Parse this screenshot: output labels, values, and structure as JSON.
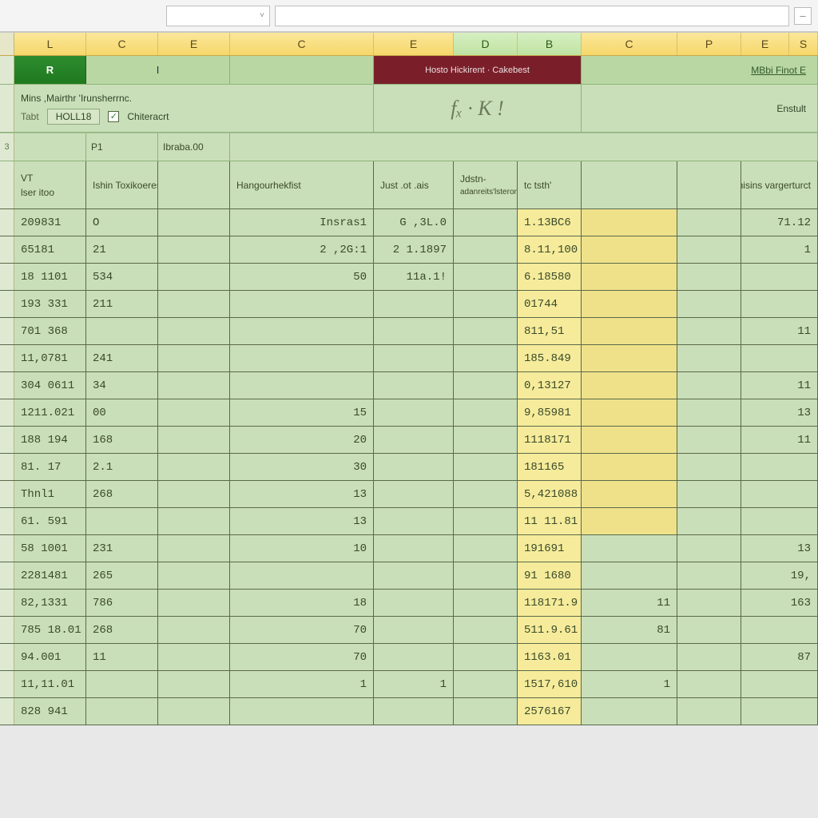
{
  "formula_bar": {
    "name_box": "",
    "dropdown_glyph": "˅"
  },
  "column_headers": [
    "L",
    "C",
    "E",
    "C",
    "E",
    "D",
    "B",
    "C",
    "P",
    "E",
    "S"
  ],
  "band": {
    "active_tab": "R",
    "tab2": "I",
    "maroon_label": "Hosto Hickirent · Cakebest",
    "right_link": "MBbi Finot E"
  },
  "toolrow": {
    "left_label": "Mins ,Mairthr 'Irunsherrnc.",
    "box_label": "HOLL18",
    "checkbox_label": "Chiteracrt",
    "checkbox_checked": true,
    "fx_label": "fₓ · K !",
    "right_link": "Enstult"
  },
  "labelrow": {
    "rowhead": "3",
    "left1": "P1",
    "left2": "Ibraba.00"
  },
  "header_row": {
    "a": "lser   itoo",
    "b": "VT",
    "d1": "Ishin Toxikoeres",
    "d2": "Hangourhekfist",
    "e": "Just .ot .ais",
    "f": "Jdstn-",
    "g": "adanreits'lsterorl",
    "h": "tc tsth'",
    "i": "",
    "j": "vhisins vargerturct"
  },
  "rows": [
    {
      "a": "209831",
      "b": "O",
      "c": "",
      "d": "Insras1",
      "e": "G ,3L.0",
      "f": "",
      "g": "1.13BC6",
      "h": "",
      "i": "",
      "j": "71.12"
    },
    {
      "a": "65181",
      "b": "21",
      "c": "",
      "d": "2  ,2G:1",
      "e": "2 1.1897",
      "f": "",
      "g": "8.11,100",
      "h": "",
      "i": "",
      "j": "1"
    },
    {
      "a": "18 1101",
      "b": "534",
      "c": "",
      "d": "50",
      "e": "11a.1!",
      "f": "",
      "g": "6.18580",
      "h": "",
      "i": "",
      "j": ""
    },
    {
      "a": "193 331",
      "b": "211",
      "c": "",
      "d": "",
      "e": "",
      "f": "",
      "g": "01744",
      "h": "",
      "i": "",
      "j": ""
    },
    {
      "a": "701 368",
      "b": "",
      "c": "",
      "d": "",
      "e": "",
      "f": "",
      "g": "811,51",
      "h": "",
      "i": "",
      "j": "11"
    },
    {
      "a": "11,0781",
      "b": "241",
      "c": "",
      "d": "",
      "e": "",
      "f": "",
      "g": "185.849",
      "h": "",
      "i": "",
      "j": ""
    },
    {
      "a": "304 0611",
      "b": "34",
      "c": "",
      "d": "",
      "e": "",
      "f": "",
      "g": "0,13127",
      "h": "",
      "i": "",
      "j": "11"
    },
    {
      "a": "1211.021",
      "b": "00",
      "c": "",
      "d": "15",
      "e": "",
      "f": "",
      "g": "9,85981",
      "h": "",
      "i": "",
      "j": "13"
    },
    {
      "a": "188 194",
      "b": "168",
      "c": "",
      "d": "20",
      "e": "",
      "f": "",
      "g": "1118171",
      "h": "",
      "i": "",
      "j": "11"
    },
    {
      "a": "81. 17",
      "b": "2.1",
      "c": "",
      "d": "30",
      "e": "",
      "f": "",
      "g": "181165",
      "h": "",
      "i": "",
      "j": ""
    },
    {
      "a": "Thnl1",
      "b": "268",
      "c": "",
      "d": "13",
      "e": "",
      "f": "",
      "g": "5,421088",
      "h": "",
      "i": "",
      "j": ""
    },
    {
      "a": "61. 591",
      "b": "",
      "c": "",
      "d": "13",
      "e": "",
      "f": "",
      "g": "11 11.81",
      "h": "",
      "i": "",
      "j": ""
    },
    {
      "a": "58 1001",
      "b": "231",
      "c": "",
      "d": "10",
      "e": "",
      "f": "",
      "g": "191691",
      "h": "",
      "i": "",
      "j": "13"
    },
    {
      "a": "2281481",
      "b": "265",
      "c": "",
      "d": "",
      "e": "",
      "f": "",
      "g": "91 1680",
      "h": "",
      "i": "",
      "j": "19,"
    },
    {
      "a": "82,1331",
      "b": "786",
      "c": "",
      "d": "18",
      "e": "",
      "f": "",
      "g": "118171.9",
      "h": "11",
      "i": "",
      "j": "163"
    },
    {
      "a": "785 18.01",
      "b": "268",
      "c": "",
      "d": "70",
      "e": "",
      "f": "",
      "g": "511.9.61",
      "h": "81",
      "i": "",
      "j": ""
    },
    {
      "a": "94.001",
      "b": "11",
      "c": "",
      "d": "70",
      "e": "",
      "f": "",
      "g": "1163.01",
      "h": "",
      "i": "",
      "j": "87"
    },
    {
      "a": "11,11.01",
      "b": "",
      "c": "",
      "d": "1",
      "e": "1",
      "f": "",
      "g": "1517,610",
      "h": "1",
      "i": "",
      "j": ""
    },
    {
      "a": "828 941",
      "b": "",
      "c": "",
      "d": "",
      "e": "",
      "f": "",
      "g": "2576167",
      "h": "",
      "i": "",
      "j": ""
    }
  ]
}
